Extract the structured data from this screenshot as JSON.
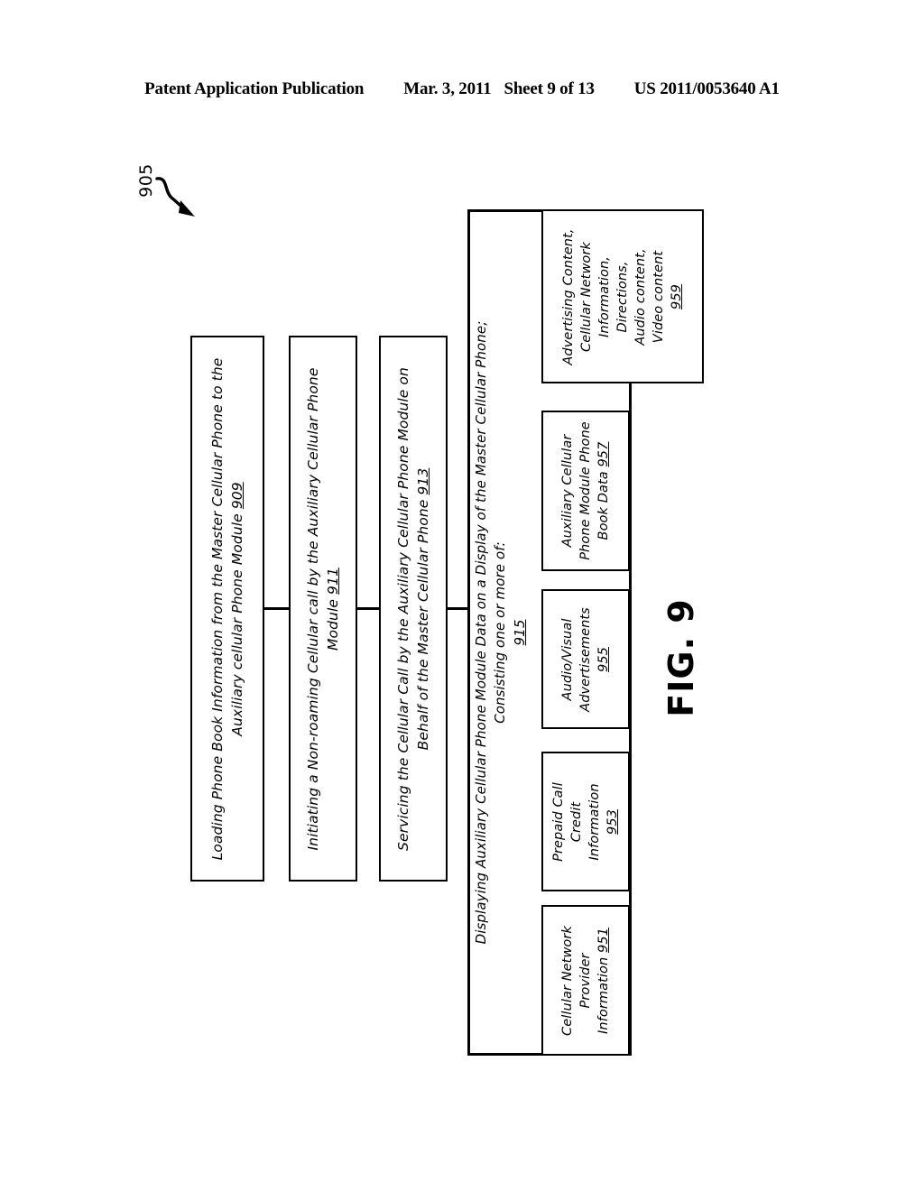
{
  "header": {
    "publication": "Patent Application Publication",
    "date": "Mar. 3, 2011",
    "sheet": "Sheet 9 of 13",
    "patent_number": "US 2011/0053640 A1"
  },
  "figure": {
    "label": "FIG. 9",
    "reference_numeral": "905"
  },
  "flowchart": {
    "steps": [
      {
        "id": "909",
        "line1": "Loading Phone Book Information from the Master Cellular Phone to the",
        "line2": "Auxiliary cellular Phone Module ",
        "number": "909"
      },
      {
        "id": "911",
        "line1": "Initiating a Non-roaming Cellular call by the Auxiliary Cellular Phone",
        "line2": "Module ",
        "number": "911"
      },
      {
        "id": "913",
        "line1": "Servicing the Cellular Call by the Auxiliary Cellular Phone Module on",
        "line2": "Behalf of the Master Cellular Phone ",
        "number": "913"
      }
    ],
    "display_step": {
      "id": "915",
      "line1": "Displaying Auxiliary Cellular Phone Module Data on a Display of the Master Cellular Phone;",
      "line2": "Consisting one or more of:",
      "number": "915"
    },
    "display_items": [
      {
        "id": "951",
        "lines": [
          "Cellular Network",
          "Provider",
          "Information "
        ],
        "number": "951"
      },
      {
        "id": "953",
        "lines": [
          "Prepaid Call",
          "Credit",
          "Information",
          ""
        ],
        "number": "953"
      },
      {
        "id": "955",
        "lines": [
          "Audio/Visual",
          "Advertisements",
          ""
        ],
        "number": "955"
      },
      {
        "id": "957",
        "lines": [
          "Auxiliary Cellular",
          "Phone Module Phone",
          "Book Data "
        ],
        "number": "957"
      },
      {
        "id": "959",
        "lines": [
          "Advertising Content,",
          "Cellular Network",
          "Information,",
          "Directions,",
          "Audio content,",
          "Video content",
          ""
        ],
        "number": "959"
      }
    ]
  }
}
